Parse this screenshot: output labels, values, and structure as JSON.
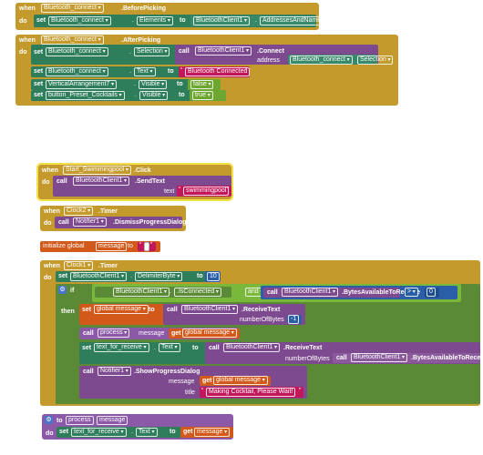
{
  "kw": {
    "when": "when",
    "do": "do",
    "set": "set",
    "call": "call",
    "to": "to",
    "get": "get",
    "if": "if",
    "then": "then",
    "and": "and",
    "initialize_global": "initialize global",
    "procedure_to": "to"
  },
  "block1": {
    "component": "Bluetooth_connect",
    "event": ".BeforePicking",
    "set_target": "Bluetooth_connect",
    "set_prop": "Elements",
    "value_obj": "BluetoothClient1",
    "value_prop": "AddressesAndNames"
  },
  "block2": {
    "component": "Bluetooth_connect",
    "event": ".AfterPicking",
    "s1_target": "Bluetooth_connect",
    "s1_prop": "Selection",
    "call_obj": "BluetoothClient1",
    "call_method": ".Connect",
    "address_label": "address",
    "addr_obj": "Bluetooth_connect",
    "addr_prop": "Selection",
    "s2_target": "Bluetooth_connect",
    "s2_prop": "Text",
    "s2_value": "Bluetooth Connected",
    "s3_target": "VerticalArrangement7",
    "s3_prop": "Visible",
    "s3_value": "false",
    "s4_target": "button_Preset_Cocktails",
    "s4_prop": "Visible",
    "s4_value": "true"
  },
  "block3": {
    "component": "Start_Swimmingpool",
    "event": ".Click",
    "call_obj": "BluetoothClient1",
    "call_method": ".SendText",
    "arg_label": "text",
    "arg_value": "swimmingpool"
  },
  "block4": {
    "component": "Clock2",
    "event": ".Timer",
    "call_obj": "Notifier1",
    "call_method": ".DismissProgressDialog"
  },
  "block5": {
    "name": "message",
    "value": ""
  },
  "block6": {
    "component": "Clock1",
    "event": ".Timer",
    "s1_target": "BluetoothClient1",
    "s1_prop": "DelimiterByte",
    "s1_value": "10",
    "cond1_obj": "BluetoothClient1",
    "cond1_prop": ".IsConnected",
    "cond2_obj": "BluetoothClient1",
    "cond2_method": ".BytesAvailableToReceive",
    "cmp_op": ">",
    "cmp_value": "0",
    "t1_var": "global message",
    "t1_obj": "BluetoothClient1",
    "t1_method": ".ReceiveText",
    "t1_arg_label": "numberOfBytes",
    "t1_arg_value": "-1",
    "t2_proc": "process",
    "t2_arg_label": "message",
    "t2_arg_value": "global message",
    "t3_target": "text_for_receive",
    "t3_prop": "Text",
    "t3_obj": "BluetoothClient1",
    "t3_method": ".ReceiveText",
    "t3_arg_label": "numberOfBytes",
    "t3_inner_obj": "BluetoothClient1",
    "t3_inner_method": ".BytesAvailableToReceive",
    "t4_obj": "Notifier1",
    "t4_method": ".ShowProgressDialog",
    "t4_msg_label": "message",
    "t4_msg_value": "global message",
    "t4_title_label": "title",
    "t4_title_value": "Making Cocktail, Please Wait!"
  },
  "block7": {
    "proc_name": "process",
    "param": "message",
    "set_target": "text_for_receive",
    "set_prop": "Text",
    "value": "message"
  },
  "colors": {
    "event": "#c49a2c",
    "set": "#2e7d5b",
    "call": "#7e4a8f",
    "text": "#c2185b",
    "boolean": "#6ea632",
    "number": "#2a5fa8",
    "control": "#5a8a36",
    "variable": "#d2591a"
  }
}
